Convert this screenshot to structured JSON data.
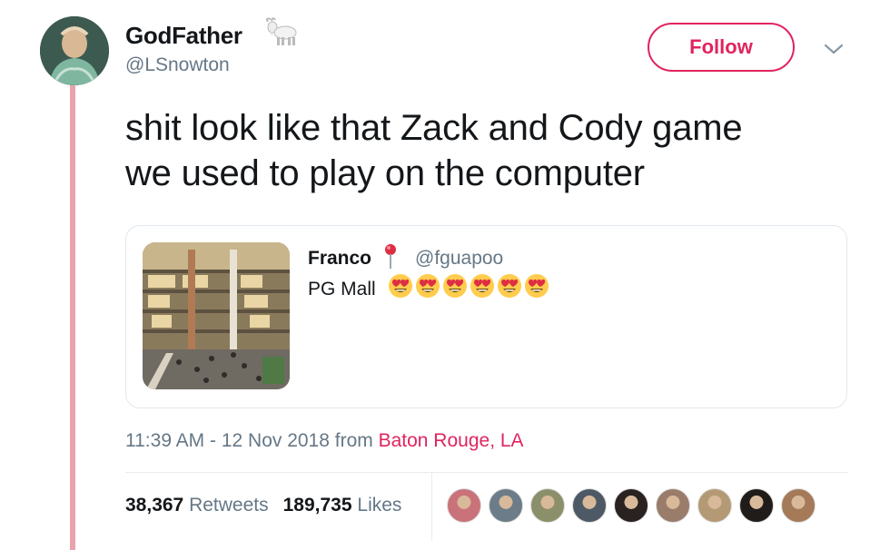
{
  "author": {
    "display_name": "GodFather",
    "handle": "@LSnowton",
    "badge_icon": "goat-icon"
  },
  "follow_button": {
    "label": "Follow"
  },
  "menu_icon": "chevron-down-icon",
  "tweet": {
    "text_line1": "shit look like that Zack and Cody game",
    "text_line2": "we used to play on the computer"
  },
  "quote": {
    "display_name": "Franco",
    "badge_icon": "pin-icon",
    "handle": "@fguapoo",
    "text": "PG Mall",
    "emoji": [
      "heart-eyes-emoji",
      "heart-eyes-emoji",
      "heart-eyes-emoji",
      "heart-eyes-emoji",
      "heart-eyes-emoji",
      "heart-eyes-emoji"
    ],
    "image": "mall-atrium-photo"
  },
  "meta": {
    "time": "11:39 AM - 12 Nov 2018 from ",
    "location": "Baton Rouge, LA"
  },
  "stats": {
    "retweets_count": "38,367",
    "retweets_label": "Retweets",
    "likes_count": "189,735",
    "likes_label": "Likes"
  },
  "likers": [
    {
      "color": "#c9727a"
    },
    {
      "color": "#6c7c88"
    },
    {
      "color": "#8b8f6a"
    },
    {
      "color": "#4d5a66"
    },
    {
      "color": "#2a2220"
    },
    {
      "color": "#9a7c6a"
    },
    {
      "color": "#b39a74"
    },
    {
      "color": "#1f1c1a"
    },
    {
      "color": "#a47a58"
    }
  ],
  "colors": {
    "accent": "#e0245e",
    "thread_line": "#e8a3ad",
    "secondary_text": "#657786"
  }
}
